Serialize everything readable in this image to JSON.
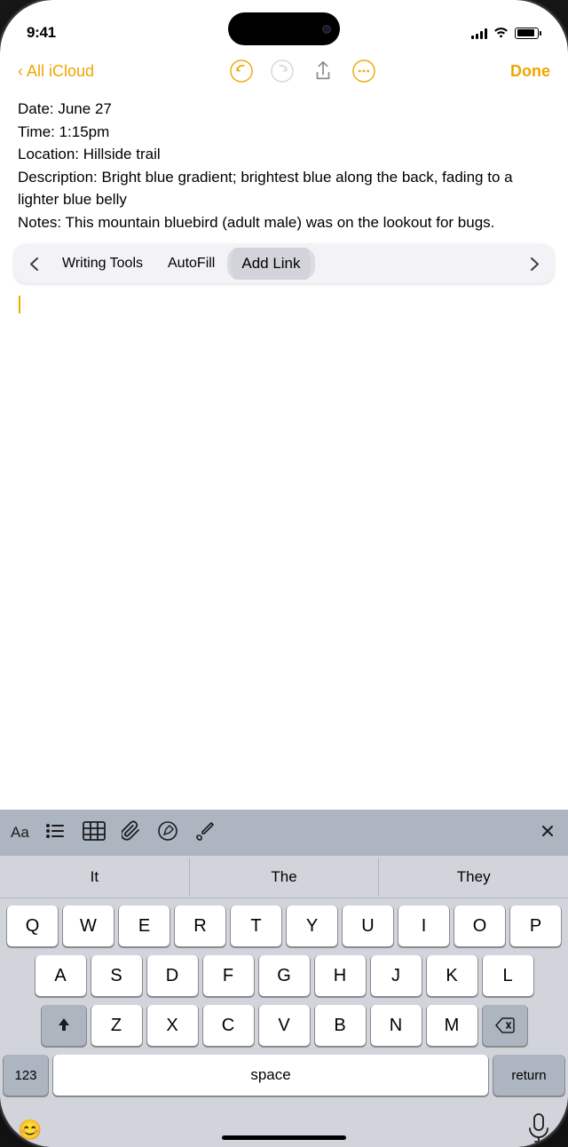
{
  "statusBar": {
    "time": "9:41",
    "signalBars": [
      4,
      6,
      8,
      10,
      13
    ],
    "batteryLevel": 90
  },
  "navBar": {
    "backLabel": "All iCloud",
    "doneLabel": "Done"
  },
  "noteContent": {
    "line1": "Date: June 27",
    "line2": "Time: 1:15pm",
    "line3": "Location: Hillside trail",
    "line4": "Description: Bright blue gradient; brightest blue along the back, fading to a lighter blue belly",
    "line5": "Notes: This mountain bluebird (adult male) was on the lookout for bugs."
  },
  "writingToolbar": {
    "prevLabel": "‹",
    "nextLabel": "›",
    "items": [
      {
        "id": "writing-tools",
        "label": "Writing Tools"
      },
      {
        "id": "autofill",
        "label": "AutoFill"
      },
      {
        "id": "add-link",
        "label": "Add Link"
      }
    ]
  },
  "keyboardToolbar": {
    "icons": [
      "Aa",
      "list",
      "table",
      "paperclip",
      "pencil",
      "brush",
      "close"
    ]
  },
  "predictive": {
    "suggestions": [
      "It",
      "The",
      "They"
    ]
  },
  "keyboard": {
    "row1": [
      "Q",
      "W",
      "E",
      "R",
      "T",
      "Y",
      "U",
      "I",
      "O",
      "P"
    ],
    "row2": [
      "A",
      "S",
      "D",
      "F",
      "G",
      "H",
      "J",
      "K",
      "L"
    ],
    "row3": [
      "Z",
      "X",
      "C",
      "V",
      "B",
      "N",
      "M"
    ],
    "bottomRow": {
      "num": "123",
      "space": "space",
      "return": "return"
    }
  },
  "bottomBar": {
    "emoji": "😊",
    "mic": "mic"
  }
}
